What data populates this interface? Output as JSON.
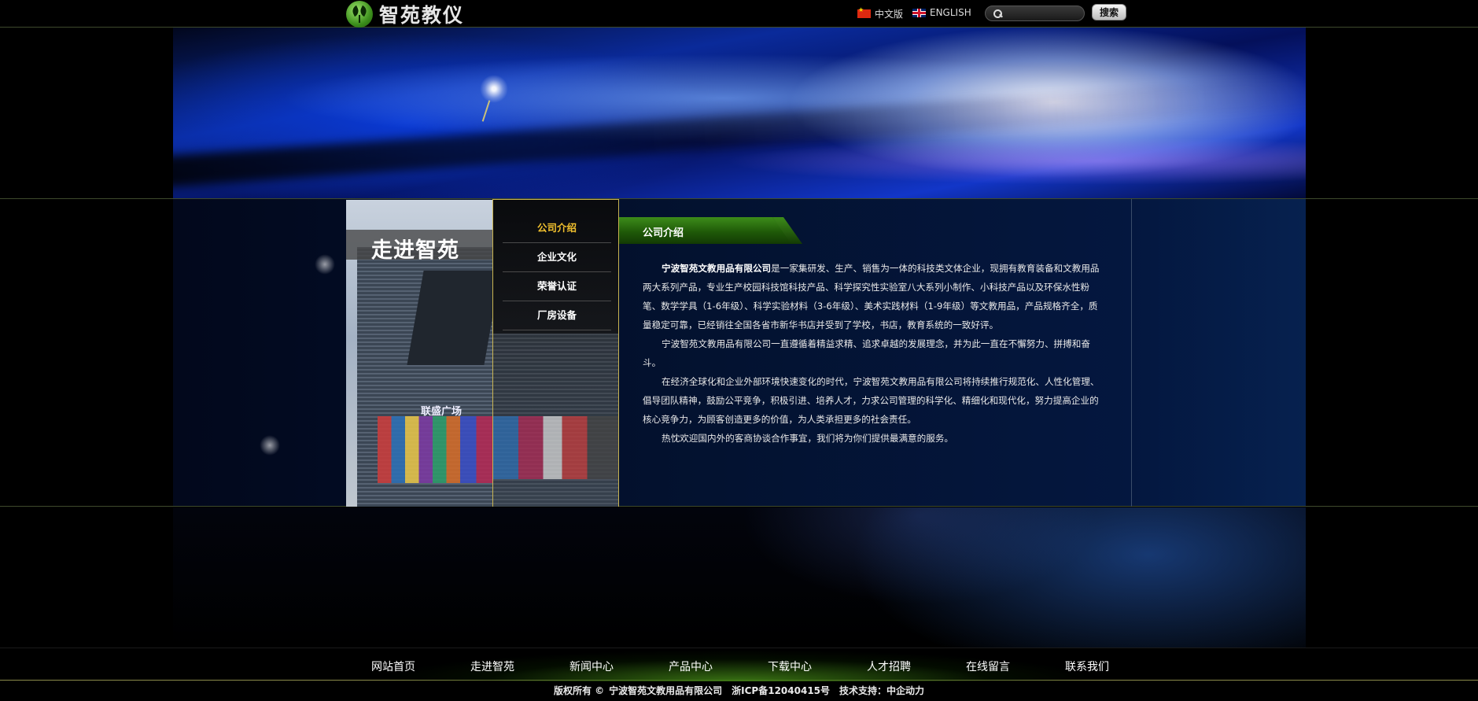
{
  "header": {
    "logo_text": "智苑教仪",
    "lang_cn": "中文版",
    "lang_en": "ENGLISH",
    "search_placeholder": "",
    "search_button": "搜索"
  },
  "sidebar": {
    "photo_title": "走进智苑",
    "photo_sign": "联盛广场",
    "items": [
      {
        "label": "公司介绍",
        "active": true
      },
      {
        "label": "企业文化",
        "active": false
      },
      {
        "label": "荣誉认证",
        "active": false
      },
      {
        "label": "厂房设备",
        "active": false
      }
    ]
  },
  "content": {
    "title": "公司介绍",
    "paragraphs": [
      {
        "bold": "宁波智苑文教用品有限公司",
        "text": "是一家集研发、生产、销售为一体的科技类文体企业，现拥有教育装备和文教用品两大系列产品，专业生产校园科技馆科技产品、科学探究性实验室八大系列小制作、小科技产品以及环保水性粉笔、数学学具（1-6年级）、科学实验材料（3-6年级）、美术实践材料（1-9年级）等文教用品，产品规格齐全，质量稳定可靠，已经销往全国各省市新华书店并受到了学校，书店，教育系统的一致好评。"
      },
      {
        "bold": "",
        "text": "宁波智苑文教用品有限公司一直遵循着精益求精、追求卓越的发展理念，并为此一直在不懈努力、拼搏和奋斗。"
      },
      {
        "bold": "",
        "text": "在经济全球化和企业外部环境快速变化的时代，宁波智苑文教用品有限公司将持续推行规范化、人性化管理、倡导团队精神，鼓励公平竞争，积极引进、培养人才，力求公司管理的科学化、精细化和现代化，努力提高企业的核心竞争力，为顾客创造更多的价值，为人类承担更多的社会责任。"
      },
      {
        "bold": "",
        "text": "热忱欢迎国内外的客商协谈合作事宜，我们将为你们提供最满意的服务。"
      }
    ]
  },
  "footer": {
    "nav": [
      "网站首页",
      "走进智苑",
      "新闻中心",
      "产品中心",
      "下载中心",
      "人才招聘",
      "在线留言",
      "联系我们"
    ],
    "copyright_label": "版权所有 ©",
    "company": "宁波智苑文教用品有限公司",
    "icp": "浙ICP备12040415号",
    "support": "技术支持：中企动力"
  },
  "colors": {
    "accent_gold": "#f2c12e",
    "title_green": "#2f7a12",
    "border_gold": "#c8b350"
  }
}
